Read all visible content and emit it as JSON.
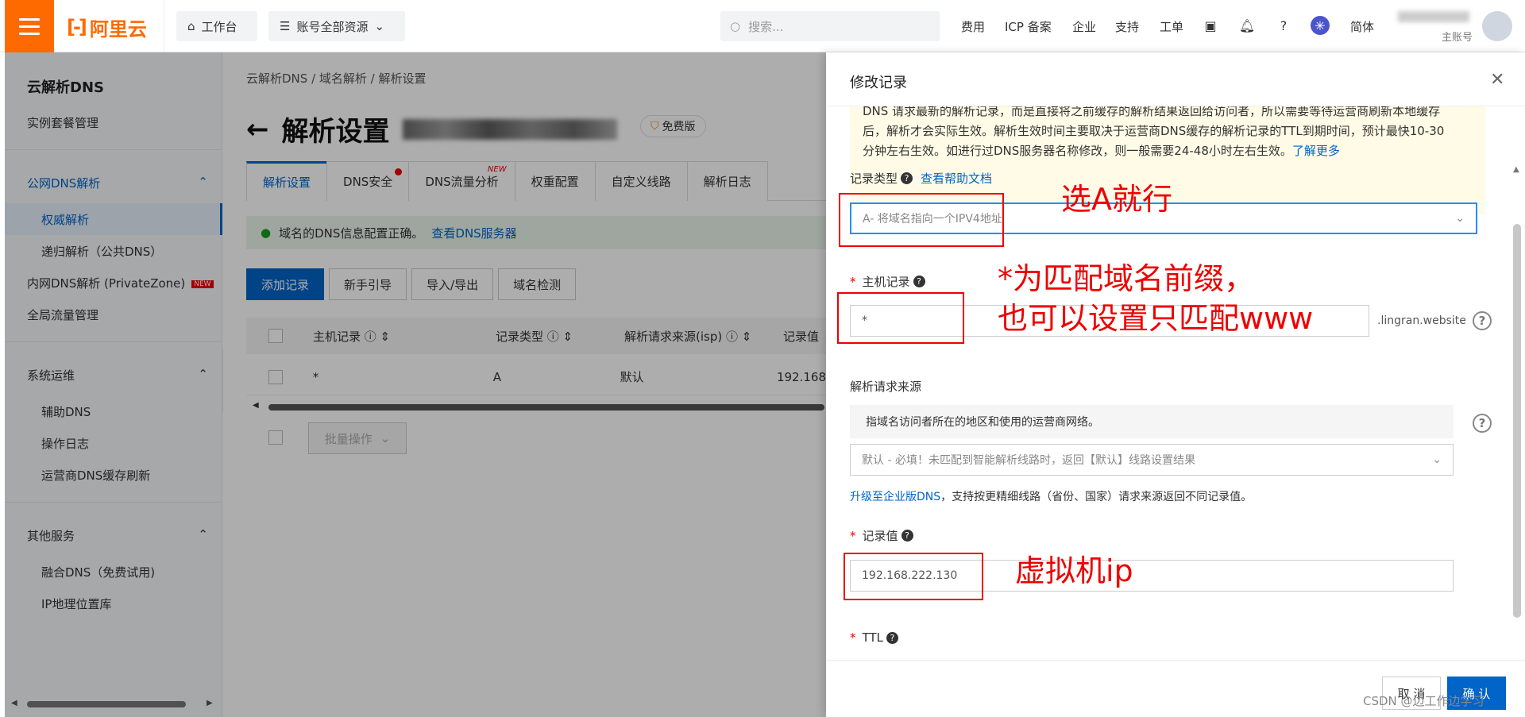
{
  "topbar": {
    "logo_text": "阿里云",
    "workbench": "工作台",
    "resources": "账号全部资源",
    "search_placeholder": "搜索...",
    "nav": [
      "费用",
      "ICP 备案",
      "企业",
      "支持",
      "工单"
    ],
    "lang": "简体",
    "account_sub": "主账号"
  },
  "sidebar": {
    "title": "云解析DNS",
    "instance_mgmt": "实例套餐管理",
    "public_dns": "公网DNS解析",
    "authoritative": "权威解析",
    "recursive": "递归解析（公共DNS）",
    "private_zone": "内网DNS解析 (PrivateZone)",
    "new_tag": "NEW",
    "global_traffic": "全局流量管理",
    "sys_ops": "系统运维",
    "aux_dns": "辅助DNS",
    "op_log": "操作日志",
    "isp_refresh": "运营商DNS缓存刷新",
    "other_services": "其他服务",
    "fusion_dns": "融合DNS（免费试用)",
    "ip_geo": "IP地理位置库"
  },
  "main": {
    "breadcrumb": [
      "云解析DNS",
      "域名解析",
      "解析设置"
    ],
    "title": "解析设置",
    "free_badge": "免费版",
    "tabs": [
      "解析设置",
      "DNS安全",
      "DNS流量分析",
      "权重配置",
      "自定义线路",
      "解析日志"
    ],
    "tab_new": "NEW",
    "notice_text": "域名的DNS信息配置正确。",
    "notice_link": "查看DNS服务器",
    "buttons": [
      "添加记录",
      "新手引导",
      "导入/导出",
      "域名检测"
    ],
    "table_headers": [
      "主机记录",
      "记录类型",
      "解析请求来源(isp)",
      "记录值"
    ],
    "row": [
      "*",
      "A",
      "默认",
      "192.168"
    ],
    "batch": "批量操作"
  },
  "drawer": {
    "title": "修改记录",
    "warn_lines": [
      "DNS 请求最新的解析记录，而是直接将之前缓存的解析结果返回给访问者，所以需要等待运营商刷新本地缓存",
      "后，解析才会实际生效。解析生效时间主要取决于运营商DNS缓存的解析记录的TTL到期时间，预计最快10-30",
      "分钟左右生效。如进行过DNS服务器名称修改，则一般需要24-48小时左右生效。"
    ],
    "learn_more": "了解更多",
    "record_type_label": "记录类型",
    "help_doc": "查看帮助文档",
    "record_type_value": "A- 将域名指向一个IPV4地址",
    "host_label": "主机记录",
    "host_value": "*",
    "domain_suffix": ".lingran.website",
    "isp_label": "解析请求来源",
    "isp_hint": "指域名访问者所在的地区和使用的运营商网络。",
    "isp_value": "默认 - 必填！未匹配到智能解析线路时，返回【默认】线路设置结果",
    "upgrade_link": "升级至企业版DNS",
    "upgrade_text": "，支持按更精细线路（省份、国家）请求来源返回不同记录值。",
    "value_label": "记录值",
    "value": "192.168.222.130",
    "ttl_label": "TTL",
    "cancel": "取 消",
    "confirm": "确 认"
  },
  "annotations": {
    "a1": "选A就行",
    "a2_line1": "*为匹配域名前缀，",
    "a2_line2": "也可以设置只匹配www",
    "a3": "虚拟机ip"
  },
  "watermark": "CSDN @边工作边学习",
  "colors": {
    "brand": "#ff6a00",
    "primary": "#0064c8",
    "annotation": "#e00000"
  }
}
